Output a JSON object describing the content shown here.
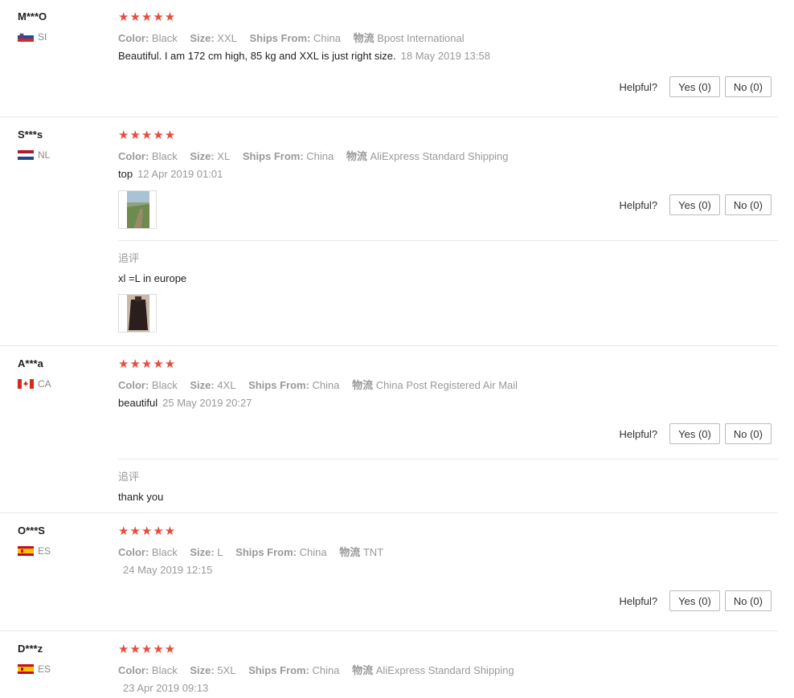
{
  "labels": {
    "color": "Color:",
    "size": "Size:",
    "ships_from": "Ships From:",
    "logistics": "物流",
    "helpful": "Helpful?",
    "followup": "追评"
  },
  "stars": "★★★★★",
  "reviews": [
    {
      "name": "M***O",
      "country": "SI",
      "color": "Black",
      "size": "XXL",
      "ships_from": "China",
      "logistics": "Bpost International",
      "text": "Beautiful. I am 172 cm high, 85 kg and XXL is just right size.",
      "date": "18 May 2019 13:58",
      "yes": "Yes (0)",
      "no": "No (0)"
    },
    {
      "name": "S***s",
      "country": "NL",
      "color": "Black",
      "size": "XL",
      "ships_from": "China",
      "logistics": "AliExpress Standard Shipping",
      "text": "top",
      "date": "12 Apr 2019 01:01",
      "yes": "Yes (0)",
      "no": "No (0)",
      "followup_text": "xl =L in europe"
    },
    {
      "name": "A***a",
      "country": "CA",
      "color": "Black",
      "size": "4XL",
      "ships_from": "China",
      "logistics": "China Post Registered Air Mail",
      "text": "beautiful",
      "date": "25 May 2019 20:27",
      "yes": "Yes (0)",
      "no": "No (0)",
      "followup_text": "thank you"
    },
    {
      "name": "O***S",
      "country": "ES",
      "color": "Black",
      "size": "L",
      "ships_from": "China",
      "logistics": "TNT",
      "text": "",
      "date": "24 May 2019 12:15",
      "yes": "Yes (0)",
      "no": "No (0)"
    },
    {
      "name": "D***z",
      "country": "ES",
      "color": "Black",
      "size": "5XL",
      "ships_from": "China",
      "logistics": "AliExpress Standard Shipping",
      "text": "",
      "date": "23 Apr 2019 09:13"
    }
  ]
}
